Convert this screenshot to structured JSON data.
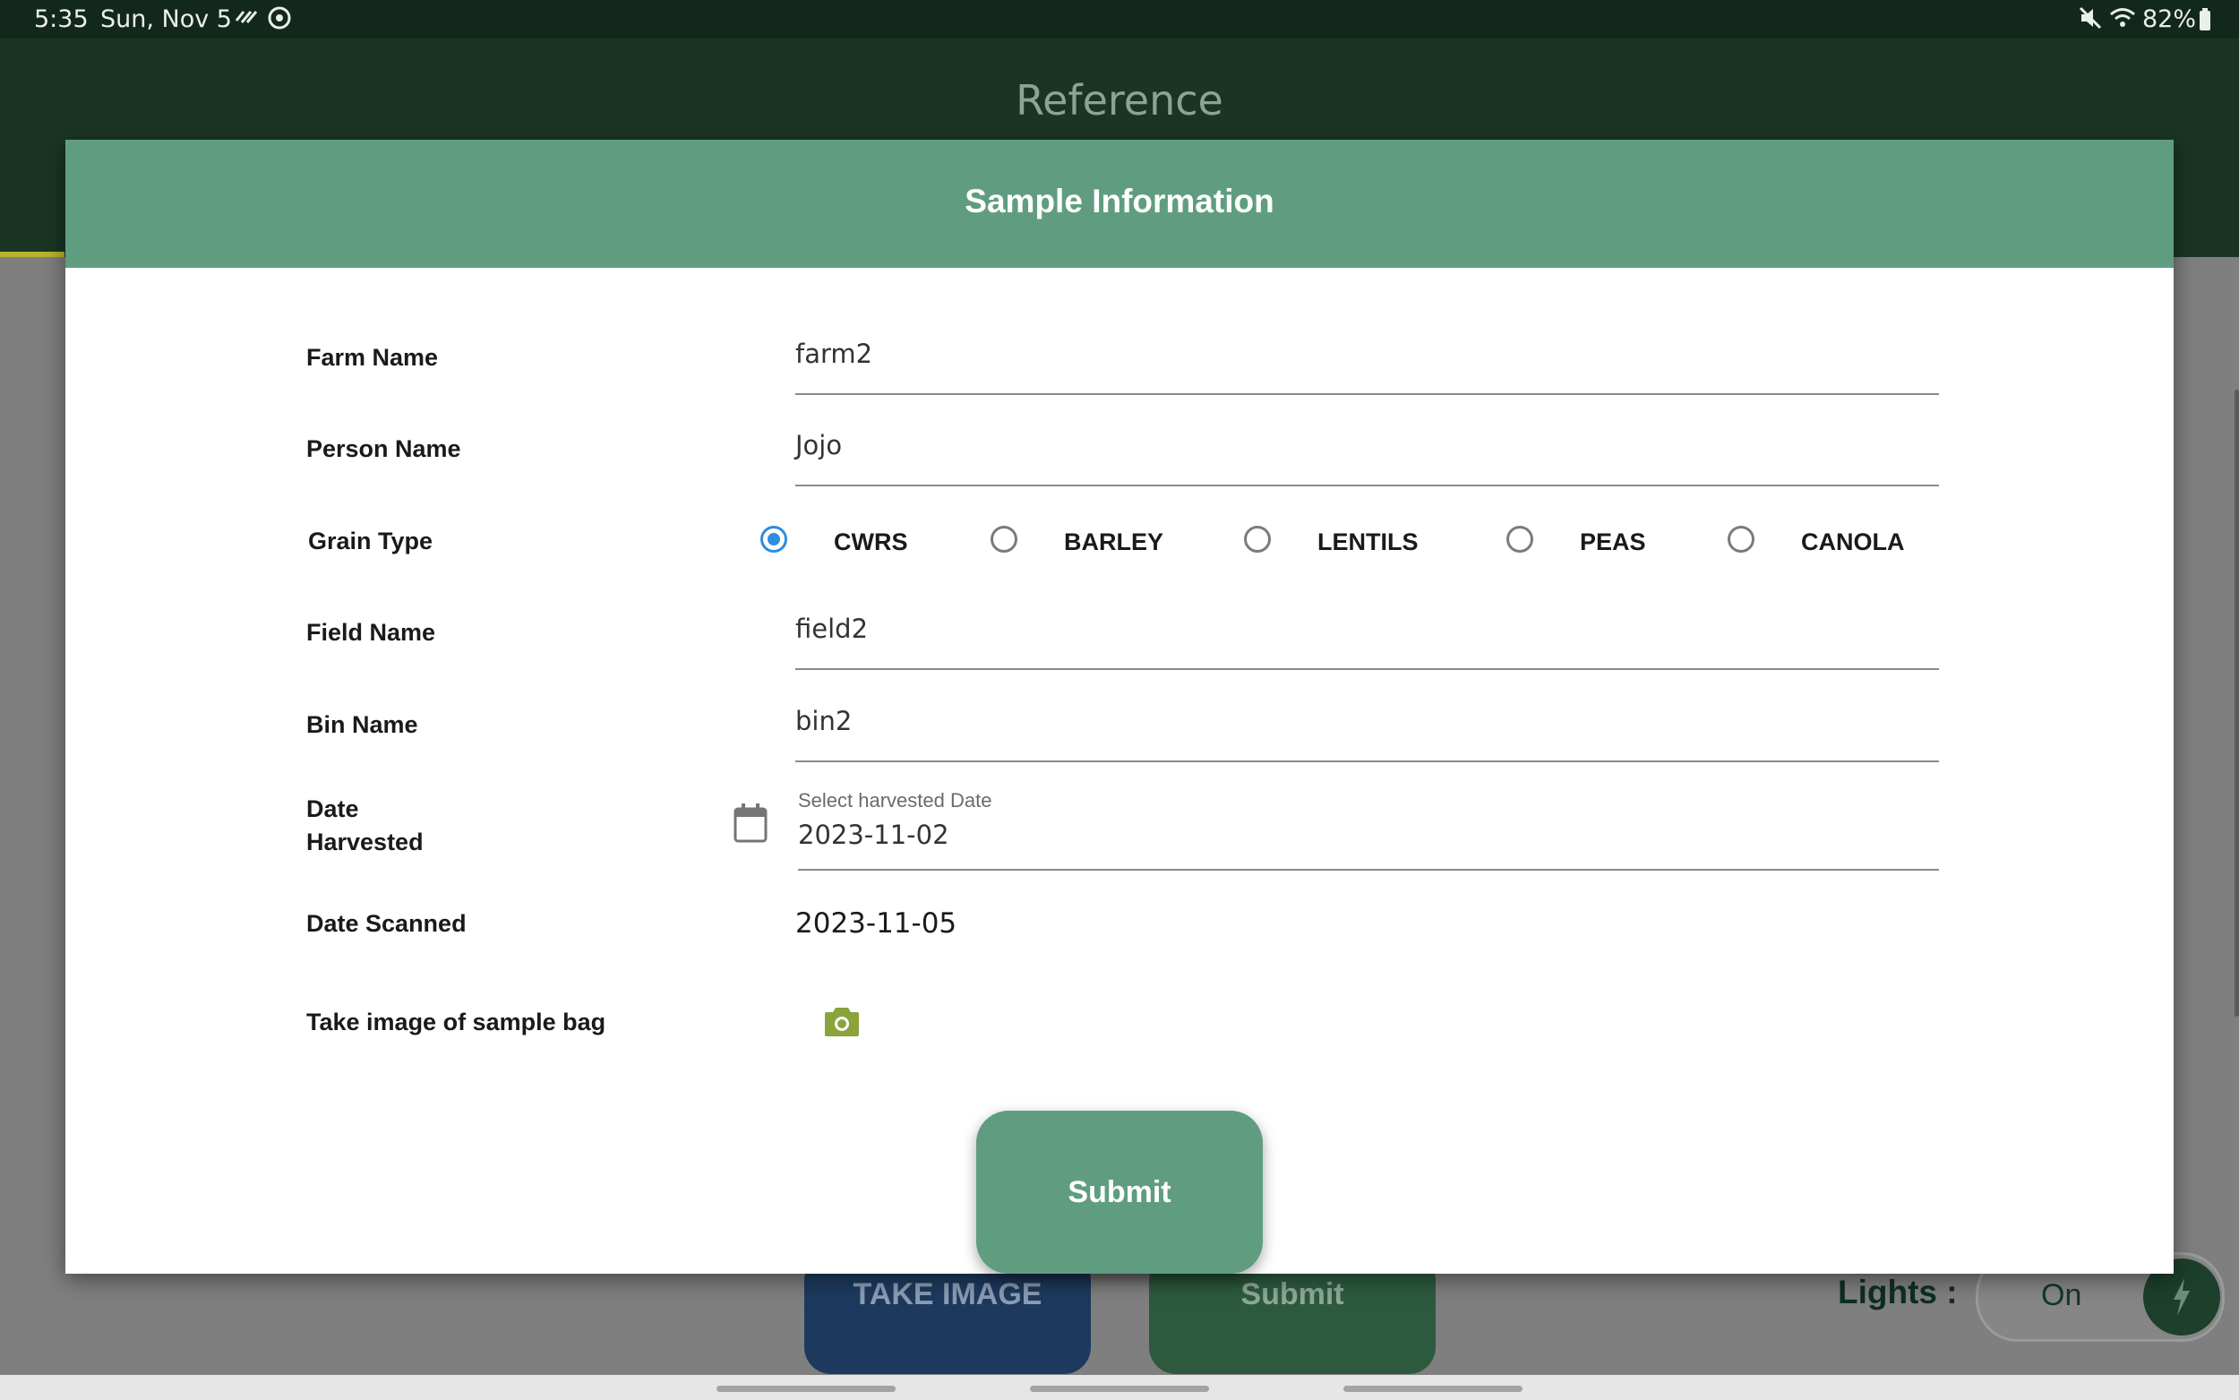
{
  "status_bar": {
    "time": "5:35",
    "date": "Sun, Nov 5",
    "battery": "82%",
    "icons": [
      "signal-wave-icon",
      "sync-icon",
      "mute-icon",
      "wifi-icon",
      "battery-icon"
    ]
  },
  "app_bar": {
    "title": "Reference"
  },
  "background": {
    "take_image_label": "TAKE IMAGE",
    "submit_label": "Submit",
    "lights_label": "Lights :",
    "lights_toggle": "On"
  },
  "dialog": {
    "title": "Sample Information",
    "fields": {
      "farm_name": {
        "label": "Farm Name",
        "value": "farm2"
      },
      "person_name": {
        "label": "Person Name",
        "value": "Jojo"
      },
      "grain_type": {
        "label": "Grain Type",
        "options": [
          "CWRS",
          "BARLEY",
          "LENTILS",
          "PEAS",
          "CANOLA"
        ],
        "selected": "CWRS"
      },
      "field_name": {
        "label": "Field Name",
        "value": "field2"
      },
      "bin_name": {
        "label": "Bin Name",
        "value": "bin2"
      },
      "date_harvested": {
        "label_line1": "Date",
        "label_line2": "Harvested",
        "caption": "Select harvested Date",
        "value": "2023-11-02"
      },
      "date_scanned": {
        "label": "Date Scanned",
        "value": "2023-11-05"
      },
      "sample_bag": {
        "label": "Take image of sample bag"
      }
    },
    "submit_label": "Submit"
  },
  "colors": {
    "header_green": "#609d80",
    "app_bar": "#1a3524",
    "radio_selected": "#2e8dde",
    "camera_icon": "#8aa33a"
  }
}
